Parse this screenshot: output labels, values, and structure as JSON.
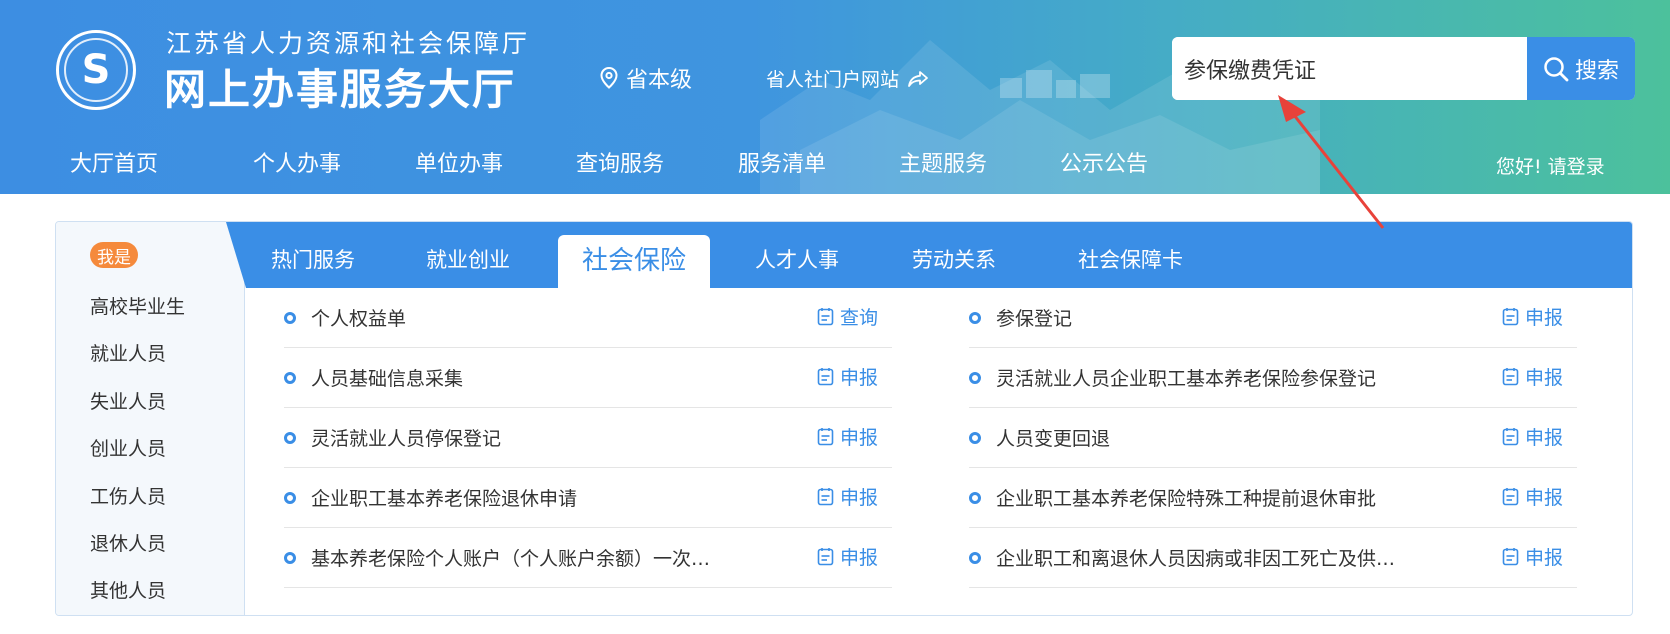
{
  "header": {
    "org_name": "江苏省人力资源和社会保障厅",
    "hall_name": "网上办事服务大厅",
    "location": "省本级",
    "portal_link": "省人社门户网站",
    "logo_icon": "social-security-logo",
    "colors": {
      "gradient_start": "#3d8ee2",
      "gradient_end": "#4cc19c",
      "accent": "#3a8ee6",
      "badge": "#f58a3c"
    }
  },
  "search": {
    "value": "参保缴费凭证",
    "button_label": "搜索"
  },
  "nav": {
    "items": [
      "大厅首页",
      "个人办事",
      "单位办事",
      "查询服务",
      "服务清单",
      "主题服务",
      "公示公告"
    ],
    "active": "大厅首页",
    "greeting": "您好!",
    "login": "请登录"
  },
  "sidebar": {
    "badge": "我是",
    "roles": [
      "高校毕业生",
      "就业人员",
      "失业人员",
      "创业人员",
      "工伤人员",
      "退休人员",
      "其他人员"
    ]
  },
  "tabs": {
    "items": [
      "热门服务",
      "就业创业",
      "社会保险",
      "人才人事",
      "劳动关系",
      "社会保障卡"
    ],
    "active": "社会保险"
  },
  "services": {
    "left": [
      {
        "label": "个人权益单",
        "action": "查询"
      },
      {
        "label": "人员基础信息采集",
        "action": "申报"
      },
      {
        "label": "灵活就业人员停保登记",
        "action": "申报"
      },
      {
        "label": "企业职工基本养老保险退休申请",
        "action": "申报"
      },
      {
        "label": "基本养老保险个人账户（个人账户余额）一次…",
        "action": "申报"
      }
    ],
    "right": [
      {
        "label": "参保登记",
        "action": "申报"
      },
      {
        "label": "灵活就业人员企业职工基本养老保险参保登记",
        "action": "申报"
      },
      {
        "label": "人员变更回退",
        "action": "申报"
      },
      {
        "label": "企业职工基本养老保险特殊工种提前退休审批",
        "action": "申报"
      },
      {
        "label": "企业职工和离退休人员因病或非因工死亡及供…",
        "action": "申报"
      }
    ]
  }
}
